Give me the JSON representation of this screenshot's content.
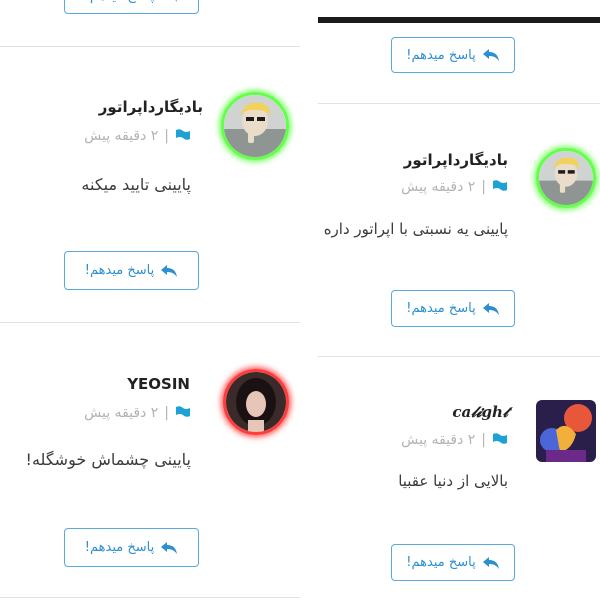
{
  "reply_label": "پاسخ میدهم!",
  "separator": "|",
  "comments_left": [
    {
      "username": "بادیگارداپراتور",
      "time": "۲ دقیقه پیش",
      "text": "پایینی تایید میکنه"
    },
    {
      "username": "YEOSIN",
      "time": "۲ دقیقه پیش",
      "text": "پایینی چشماش خوشگله!"
    }
  ],
  "comments_right": [
    {
      "username": "بادیگارداپراتور",
      "time": "۲ دقیقه پیش",
      "text": "پایینی یه نسبتی با اپراتور داره"
    },
    {
      "username": "ca𝓁𝓲gh𝓉",
      "time": "۲ دقیقه پیش",
      "text": "بالایی از دنیا عقبیا"
    }
  ],
  "colors": {
    "accent": "#2d8fd0",
    "button_border": "#5aa9dd",
    "flag": "#1ea2d6",
    "meta_gray": "#b3b3b3",
    "glow_green": "#63ff4a",
    "glow_red": "#ff3b3b"
  },
  "icons": {
    "reply": "reply-arrow-icon",
    "flag": "flag-icon"
  }
}
